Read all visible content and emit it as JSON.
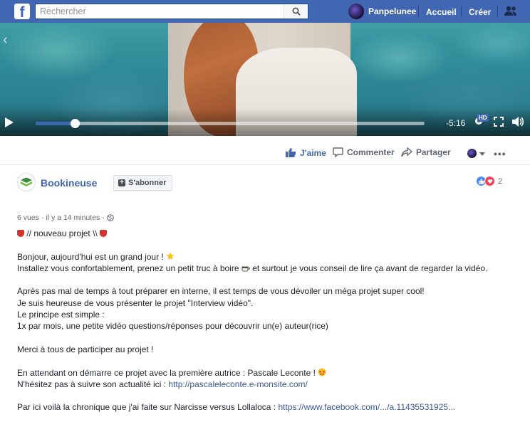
{
  "topbar": {
    "search_placeholder": "Rechercher",
    "profile_name": "Panpelunee",
    "home_label": "Accueil",
    "create_label": "Créer"
  },
  "video": {
    "time_remaining": "-5:16",
    "hd_label": "HD",
    "progress_fraction": 0.1
  },
  "actions": {
    "like": "J'aime",
    "comment": "Commenter",
    "share": "Partager"
  },
  "post": {
    "page_name": "Bookineuse",
    "subscribe_label": "S'abonner",
    "reaction_count": "2",
    "views": "6 vues",
    "sep1": "·",
    "time": "il y a 14 minutes",
    "sep2": "·",
    "heading": "// nouveau projet \\\\",
    "line1": "Bonjour, aujourd'hui est un grand jour !",
    "line2a": "Installez vous confortablement, prenez un petit truc à boire",
    "line2b": "et surtout je vous conseil de lire ça avant de regarder la vidéo.",
    "line3": "Après pas mal de temps à tout préparer en interne, il est temps de vous dévoiler un méga projet super cool!",
    "line4": "Je suis heureuse de vous présenter le projet \"Interview vidéo\".",
    "line5": "Le principe est simple :",
    "line6": "1x par mois, une petite vidéo questions/réponses pour découvrir un(e) auteur(rice)",
    "line7": "Merci à tous de participer au projet !",
    "line8": "En attendant on démarre ce projet avec la première autrice : Pascale Leconte !",
    "line9_prefix": "N'hésitez pas à suivre son actualité ici :",
    "line9_link": "http://pascaleleconte.e-monsite.com/",
    "line10_prefix": "Par ici voilà la chronique que j'ai faite sur Narcisse versus Lollaloca :",
    "line10_link": "https://www.facebook.com/.../a.11435531925..."
  },
  "colors": {
    "brand": "#4267b2",
    "link": "#385898"
  }
}
